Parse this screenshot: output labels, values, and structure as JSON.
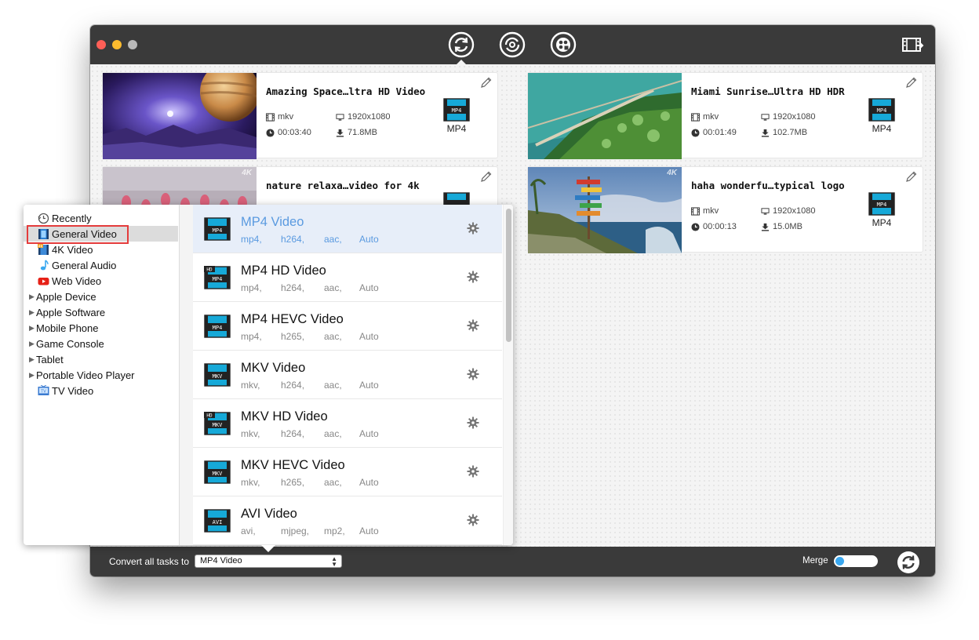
{
  "colors": {
    "titlebar": "#3a3a3a",
    "selected_text": "#5a9ae0",
    "highlight_box": "#e43c3c",
    "toggle_knob": "#3aa8f0"
  },
  "toolbar": {
    "icons": [
      "convert-icon",
      "rotate-edit-icon",
      "toolbox-icon",
      "film-strip-icon"
    ]
  },
  "tasks": [
    {
      "title": "Amazing Space…ltra HD Video",
      "format": "mkv",
      "resolution": "1920x1080",
      "duration": "00:03:40",
      "size": "71.8MB",
      "target": "MP4"
    },
    {
      "title": "Miami Sunrise…Ultra HD HDR",
      "format": "mkv",
      "resolution": "1920x1080",
      "duration": "00:01:49",
      "size": "102.7MB",
      "target": "MP4"
    },
    {
      "title": "nature relaxa…video for 4k",
      "badge": "4K"
    },
    {
      "title": "haha wonderfu…typical logo",
      "format": "mkv",
      "resolution": "1920x1080",
      "duration": "00:00:13",
      "size": "15.0MB",
      "target": "MP4",
      "badge": "4K"
    }
  ],
  "categories": [
    {
      "label": "Recently",
      "icon": "clock-icon",
      "expandable": false
    },
    {
      "label": "General Video",
      "icon": "film-icon",
      "expandable": false,
      "selected": true
    },
    {
      "label": "4K Video",
      "icon": "4k-film-icon",
      "expandable": false
    },
    {
      "label": "General Audio",
      "icon": "music-note-icon",
      "expandable": false
    },
    {
      "label": "Web Video",
      "icon": "youtube-icon",
      "expandable": false
    },
    {
      "label": "Apple Device",
      "expandable": true
    },
    {
      "label": "Apple Software",
      "expandable": true
    },
    {
      "label": "Mobile Phone",
      "expandable": true
    },
    {
      "label": "Game Console",
      "expandable": true
    },
    {
      "label": "Tablet",
      "expandable": true
    },
    {
      "label": "Portable Video Player",
      "expandable": true
    },
    {
      "label": "TV Video",
      "icon": "tv-icon",
      "expandable": false
    }
  ],
  "presets": [
    {
      "name": "MP4 Video",
      "badge": "MP4",
      "hd": false,
      "container": "mp4,",
      "video": "h264,",
      "audio": "aac,",
      "quality": "Auto",
      "selected": true
    },
    {
      "name": "MP4 HD Video",
      "badge": "MP4",
      "hd": true,
      "container": "mp4,",
      "video": "h264,",
      "audio": "aac,",
      "quality": "Auto"
    },
    {
      "name": "MP4 HEVC Video",
      "badge": "MP4",
      "hd": false,
      "container": "mp4,",
      "video": "h265,",
      "audio": "aac,",
      "quality": "Auto"
    },
    {
      "name": "MKV Video",
      "badge": "MKV",
      "hd": false,
      "container": "mkv,",
      "video": "h264,",
      "audio": "aac,",
      "quality": "Auto"
    },
    {
      "name": "MKV HD Video",
      "badge": "MKV",
      "hd": true,
      "container": "mkv,",
      "video": "h264,",
      "audio": "aac,",
      "quality": "Auto"
    },
    {
      "name": "MKV HEVC Video",
      "badge": "MKV",
      "hd": false,
      "container": "mkv,",
      "video": "h265,",
      "audio": "aac,",
      "quality": "Auto"
    },
    {
      "name": "AVI Video",
      "badge": "AVI",
      "hd": false,
      "container": "avi,",
      "video": "mjpeg,",
      "audio": "mp2,",
      "quality": "Auto"
    }
  ],
  "bottom": {
    "convert_label": "Convert all tasks to",
    "convert_value": "MP4 Video",
    "merge_label": "Merge",
    "merge_on": false
  }
}
